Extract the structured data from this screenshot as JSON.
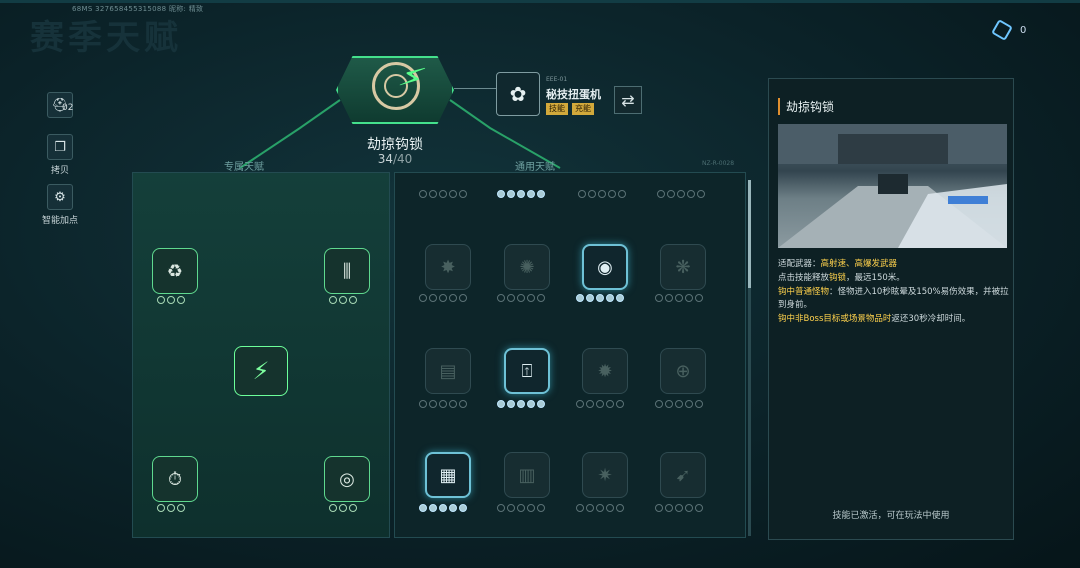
{
  "header": {
    "uid_text": "68MS  327658455315088        昵称:  精致",
    "bg_title": "赛季天赋",
    "currency_value": "0"
  },
  "tools": {
    "counter": "02",
    "copy_label": "拷贝",
    "smart_label": "智能加点"
  },
  "core_skill": {
    "name": "劫掠钩锁",
    "points": "34",
    "max": "/40"
  },
  "gadget": {
    "code": "EEE-01",
    "name": "秘技扭蛋机",
    "tags": [
      "技能",
      "充能"
    ]
  },
  "panels": {
    "exclusive_label": "专属天赋",
    "common_label": "通用天赋",
    "deco_code": "NZ-R-0028"
  },
  "info": {
    "title": "劫掠钩锁",
    "weapon_prefix": "适配武器：",
    "weapon_value": "高射速、高爆发武器",
    "line2_a": "点击技能释放",
    "line2_hl": "钩锁",
    "line2_b": "，最远150米。",
    "line3_hl": "钩中普通怪物",
    "line3_b": "：怪物进入10秒眩晕及150%易伤效果，并被拉到身前。",
    "line4_hl": "钩中非Boss目标或场景物品时",
    "line4_b": "返还30秒冷却时间。",
    "footer": "技能已激活，可在玩法中使用"
  },
  "colors": {
    "accent_green": "#44e08c",
    "accent_blue": "#6ec1d6",
    "highlight": "#ffd24d"
  }
}
